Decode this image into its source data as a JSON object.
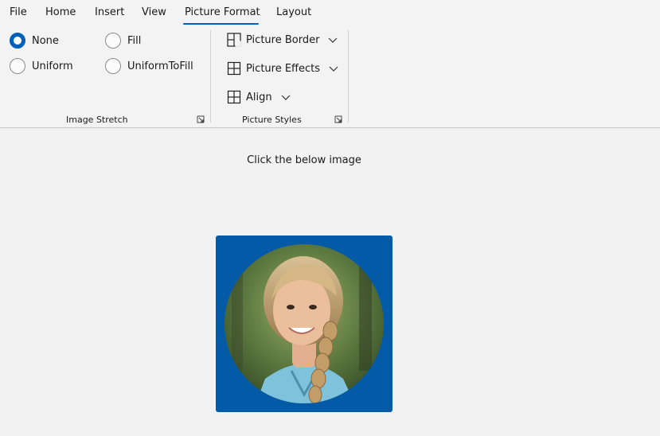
{
  "ribbon": {
    "tabs": [
      {
        "label": "File"
      },
      {
        "label": "Home"
      },
      {
        "label": "Insert"
      },
      {
        "label": "View"
      },
      {
        "label": "Picture Format",
        "selected": true
      },
      {
        "label": "Layout"
      }
    ],
    "image_stretch": {
      "group_label": "Image Stretch",
      "options": [
        {
          "label": "None",
          "checked": true
        },
        {
          "label": "Fill",
          "checked": false
        },
        {
          "label": "Uniform",
          "checked": false
        },
        {
          "label": "UniformToFill",
          "checked": false
        }
      ]
    },
    "picture_styles": {
      "group_label": "Picture Styles",
      "buttons": [
        {
          "label": "Picture Border",
          "icon": "picture-border-icon"
        },
        {
          "label": "Picture Effects",
          "icon": "picture-effects-icon"
        },
        {
          "label": "Align",
          "icon": "align-icon"
        }
      ]
    },
    "accent_color": "#005fb8"
  },
  "content": {
    "instruction": "Click the below image",
    "image_frame_color": "#035aa6"
  }
}
